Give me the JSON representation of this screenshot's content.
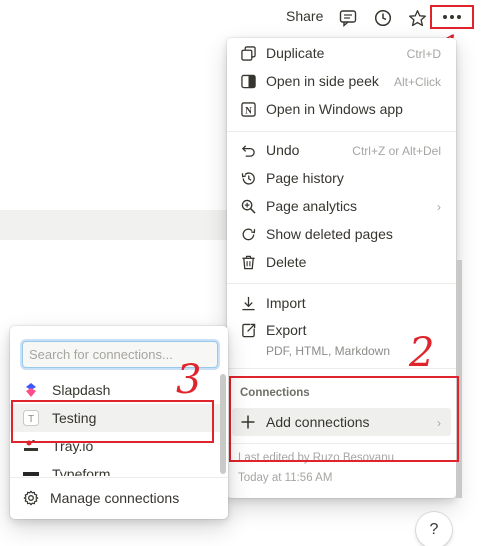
{
  "topbar": {
    "share_label": "Share",
    "icons": [
      "comment-icon",
      "clock-icon",
      "star-icon",
      "more-icon"
    ]
  },
  "menu": {
    "group1": [
      {
        "label": "Duplicate",
        "shortcut": "Ctrl+D",
        "icon": "duplicate-icon"
      },
      {
        "label": "Open in side peek",
        "shortcut": "Alt+Click",
        "icon": "side-peek-icon"
      },
      {
        "label": "Open in Windows app",
        "icon": "notion-icon"
      }
    ],
    "group2": [
      {
        "label": "Undo",
        "shortcut": "Ctrl+Z or Alt+Del",
        "icon": "undo-icon"
      },
      {
        "label": "Page history",
        "icon": "history-icon"
      },
      {
        "label": "Page analytics",
        "icon": "analytics-icon"
      },
      {
        "label": "Show deleted pages",
        "icon": "restore-icon"
      },
      {
        "label": "Delete",
        "icon": "trash-icon"
      }
    ],
    "group3": [
      {
        "label": "Import",
        "icon": "import-icon"
      },
      {
        "label": "Export",
        "icon": "export-icon",
        "sublabel": "PDF, HTML, Markdown"
      }
    ],
    "connections_heading": "Connections",
    "add_connections_label": "Add connections",
    "footer_line1": "Last edited by Ruzo Besovanu",
    "footer_line2": "Today at 11:56 AM"
  },
  "connections_popover": {
    "search_placeholder": "Search for connections...",
    "items": [
      {
        "name": "Slapdash",
        "icon": "slapdash-logo"
      },
      {
        "name": "Testing",
        "icon": "letter-t-icon"
      },
      {
        "name": "Tray.io",
        "icon": "trayio-logo"
      },
      {
        "name": "Typeform",
        "icon": "typeform-logo"
      }
    ],
    "manage_label": "Manage connections"
  },
  "help_label": "?",
  "annotations": {
    "one": "1",
    "two": "2",
    "three": "3"
  },
  "colors": {
    "annotation_red": "#e0242c",
    "text": "#37352f",
    "muted": "#a6a5a2",
    "hover": "#efefed"
  }
}
